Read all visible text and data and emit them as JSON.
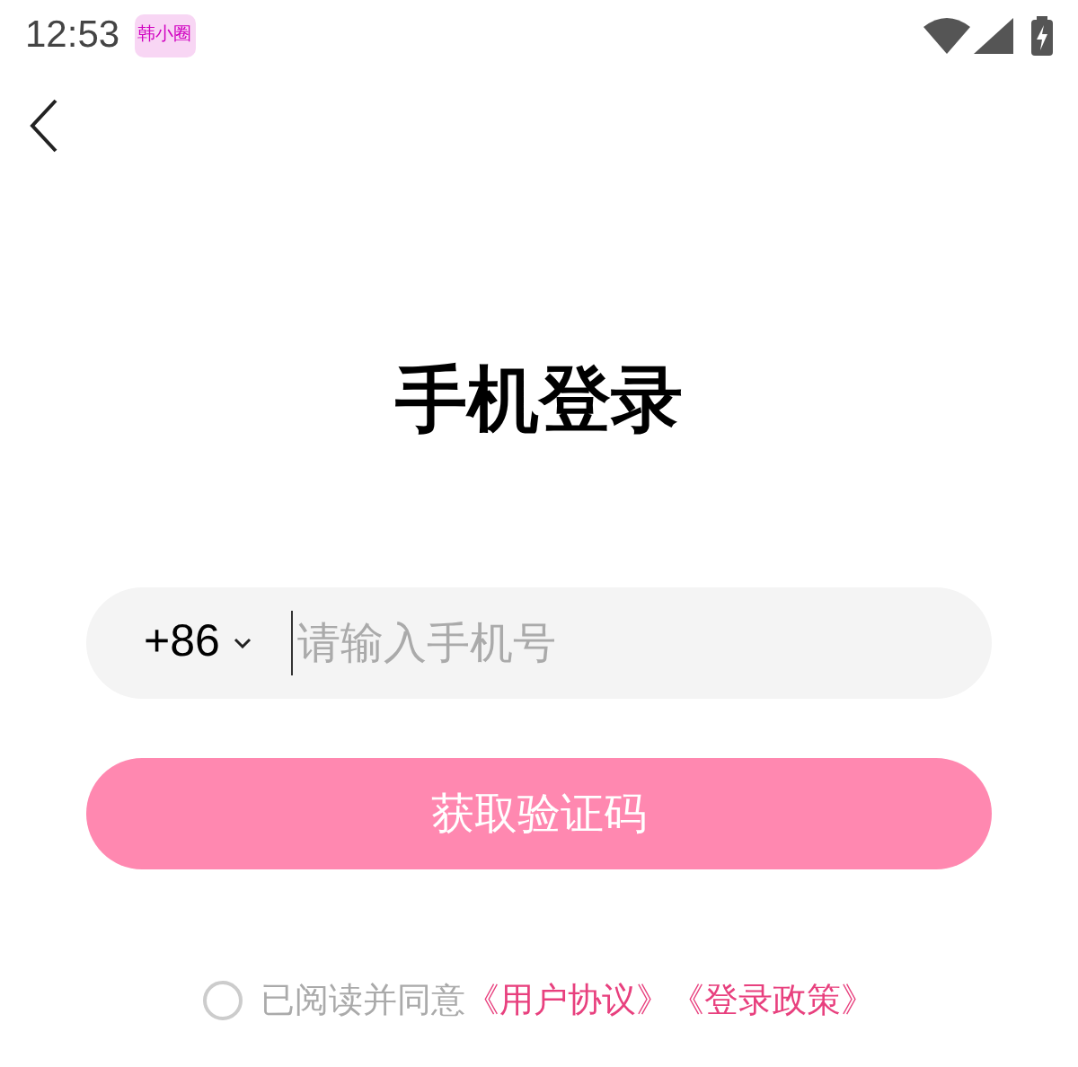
{
  "status_bar": {
    "time": "12:53",
    "app_icon_label": "韩小圈"
  },
  "title": "手机登录",
  "phone_field": {
    "country_code": "+86",
    "placeholder": "请输入手机号"
  },
  "submit_button": {
    "label": "获取验证码",
    "disabled": true
  },
  "agreement": {
    "checked": false,
    "text": "已阅读并同意",
    "links": [
      "《用户协议》",
      "《登录政策》"
    ]
  }
}
